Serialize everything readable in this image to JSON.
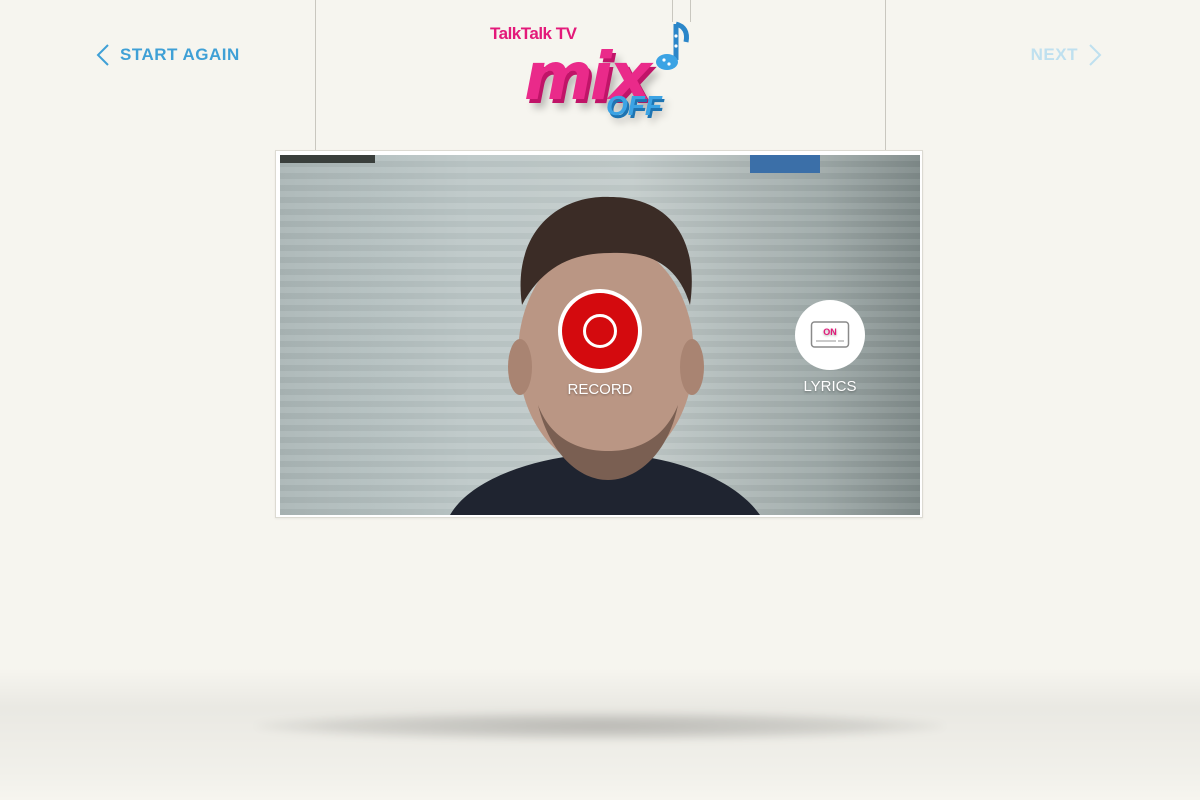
{
  "nav": {
    "back_label": "START AGAIN",
    "next_label": "NEXT"
  },
  "logo": {
    "brand": "TalkTalk TV",
    "title": "mix",
    "subtitle": "OFF"
  },
  "controls": {
    "record_label": "RECORD",
    "lyrics_label": "LYRICS",
    "lyrics_state": "ON"
  },
  "colors": {
    "accent_blue": "#3fa0d6",
    "record_red": "#d40a0e",
    "brand_pink": "#e3197a"
  }
}
